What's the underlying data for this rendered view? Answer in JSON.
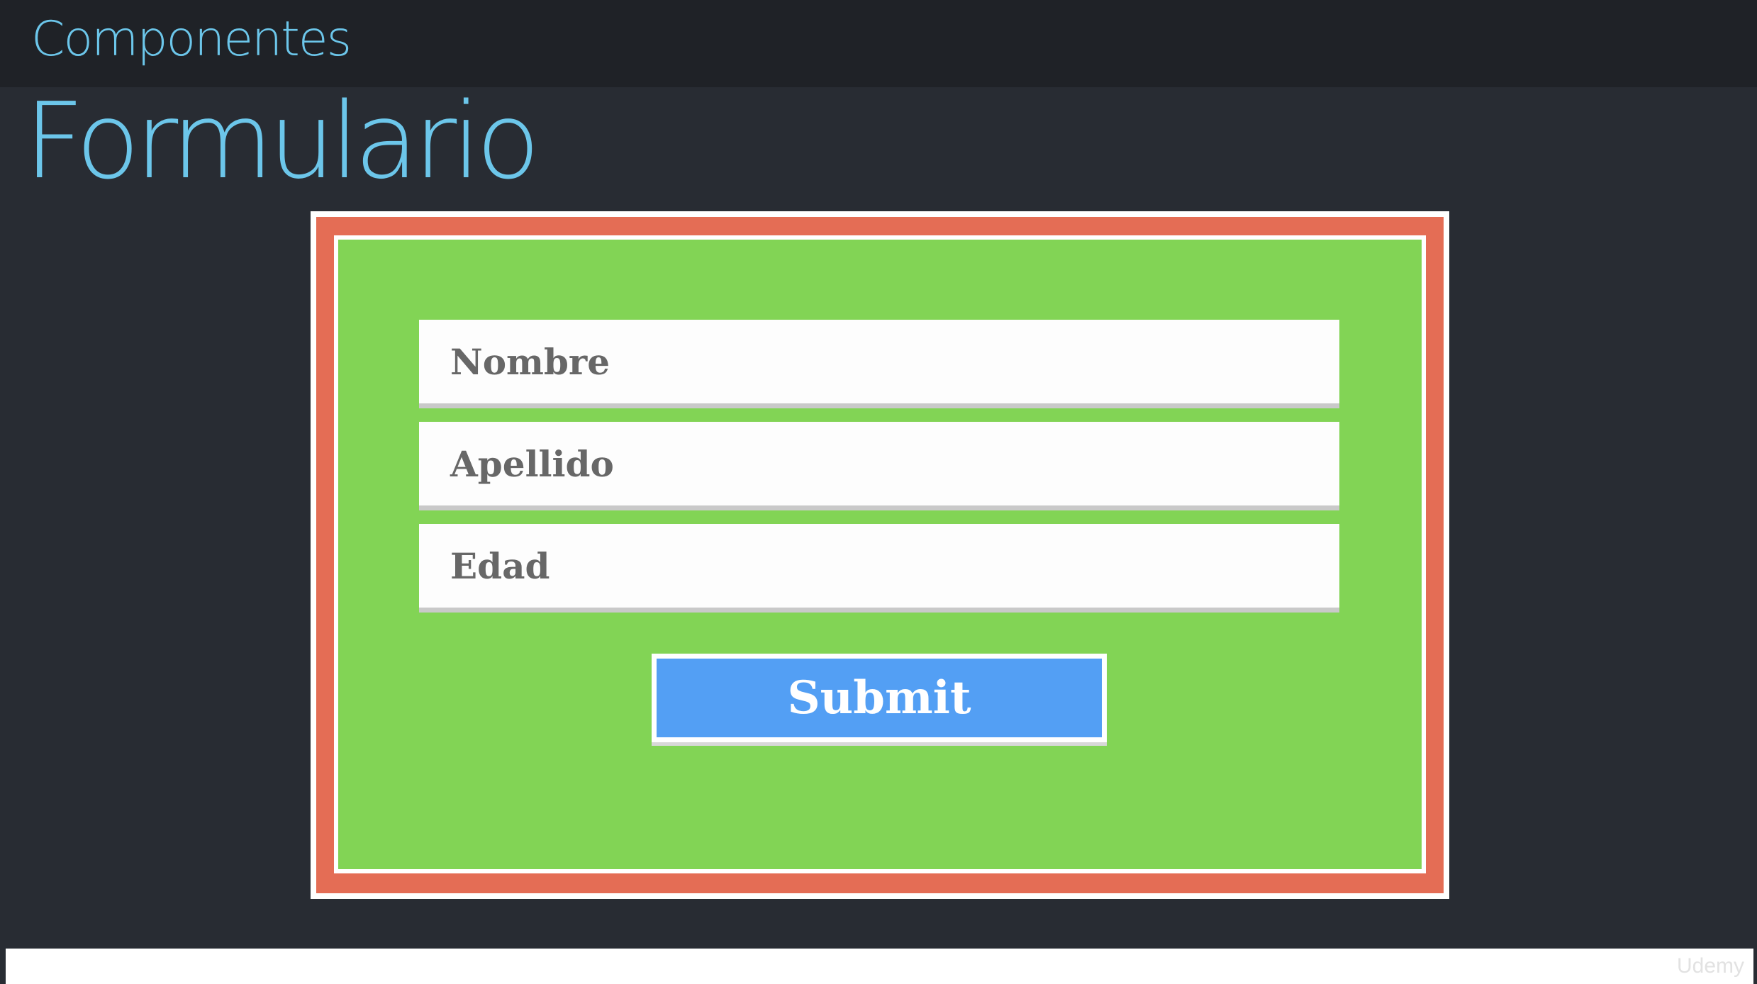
{
  "header": {
    "section": "Componentes",
    "title": "Formulario"
  },
  "form": {
    "fields": [
      {
        "placeholder": "Nombre"
      },
      {
        "placeholder": "Apellido"
      },
      {
        "placeholder": "Edad"
      }
    ],
    "submit_label": "Submit"
  },
  "colors": {
    "background": "#282c33",
    "header_bar": "#1f2227",
    "title_text": "#6cc6ea",
    "frame_red": "#e46d55",
    "form_green": "#82d455",
    "submit_blue": "#539ff4"
  },
  "watermark": "Udemy"
}
